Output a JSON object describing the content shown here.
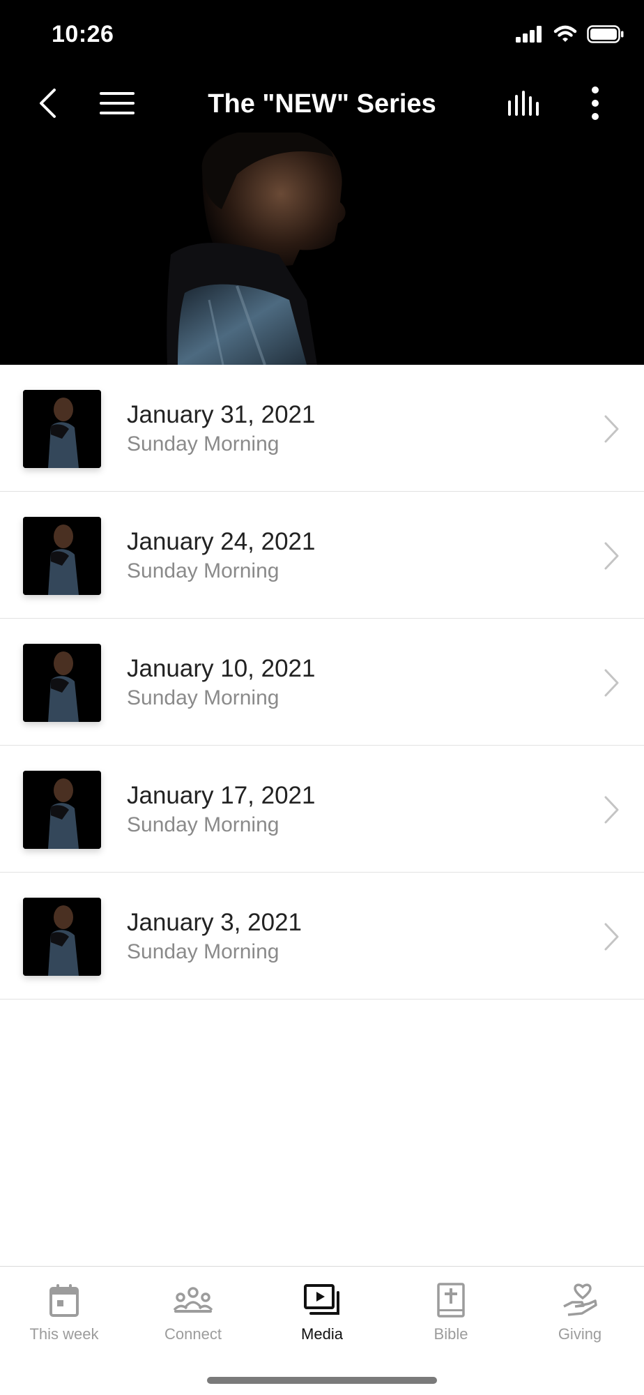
{
  "status_bar": {
    "time": "10:26"
  },
  "header": {
    "title": "The \"NEW\" Series"
  },
  "sermons": [
    {
      "title": "January 31, 2021",
      "subtitle": "Sunday Morning"
    },
    {
      "title": "January 24, 2021",
      "subtitle": "Sunday Morning"
    },
    {
      "title": "January 10, 2021",
      "subtitle": "Sunday Morning"
    },
    {
      "title": "January 17, 2021",
      "subtitle": "Sunday Morning"
    },
    {
      "title": "January 3, 2021",
      "subtitle": "Sunday Morning"
    }
  ],
  "tabs": [
    {
      "label": "This week",
      "icon": "calendar-icon"
    },
    {
      "label": "Connect",
      "icon": "people-icon"
    },
    {
      "label": "Media",
      "icon": "media-icon",
      "active": true
    },
    {
      "label": "Bible",
      "icon": "bible-icon"
    },
    {
      "label": "Giving",
      "icon": "giving-icon"
    }
  ],
  "colors": {
    "header_bg": "#000000",
    "active_tab": "#111111",
    "inactive_tab": "#9c9c9c"
  }
}
